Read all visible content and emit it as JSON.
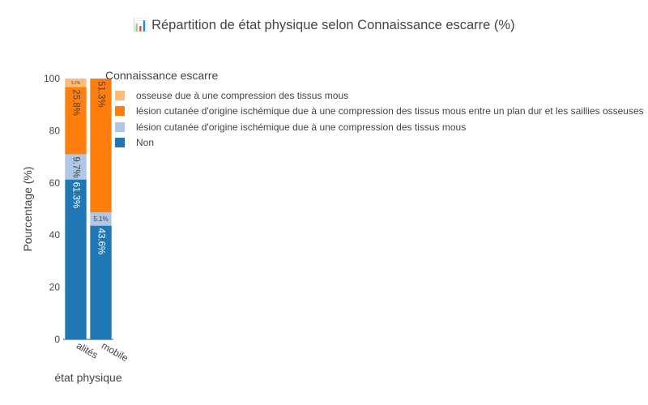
{
  "title": "Répartition de état physique  selon Connaissance escarre (%)",
  "title_icon": "bar-chart-emoji",
  "chart_data": {
    "type": "bar",
    "barmode": "stack",
    "title": "Répartition de état physique  selon Connaissance escarre (%)",
    "xlabel": "état physique",
    "ylabel": "Pourcentage (%)",
    "categories": [
      "alités",
      "mobile"
    ],
    "ylim": [
      0,
      100
    ],
    "yticks": [
      0,
      20,
      40,
      60,
      80,
      100
    ],
    "grid": false,
    "legend_title": "Connaissance escarre",
    "legend_position": "top-left",
    "series": [
      {
        "name": "Non",
        "color": "#1f77b4",
        "values": [
          61.3,
          43.6
        ],
        "labels": [
          "61.3%",
          "43.6%"
        ]
      },
      {
        "name": "lésion cutanée d'origine ischémique due à une compression des tissus mous",
        "color": "#aec7e8",
        "values": [
          9.7,
          5.1
        ],
        "labels": [
          "9.7%",
          "5.1%"
        ]
      },
      {
        "name": "lésion cutanée d'origine ischémique due à une compression des tissus mous entre un plan dur et les saillies osseuses",
        "color": "#ff7f0e",
        "values": [
          25.8,
          51.3
        ],
        "labels": [
          "25.8%",
          "51.3%"
        ]
      },
      {
        "name": "osseuse due à une compression des tissus mous",
        "color": "#ffbb78",
        "values": [
          3.2,
          0
        ],
        "labels": [
          "3.2%",
          ""
        ]
      }
    ]
  }
}
